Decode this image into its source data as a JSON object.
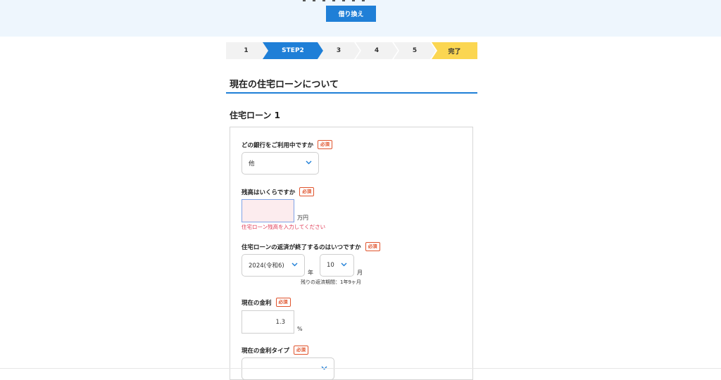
{
  "header": {
    "switch_button_label": "借り換え"
  },
  "steps": [
    {
      "label": "1",
      "state": "done"
    },
    {
      "label": "STEP2",
      "state": "active"
    },
    {
      "label": "3",
      "state": "todo"
    },
    {
      "label": "4",
      "state": "todo"
    },
    {
      "label": "5",
      "state": "todo"
    },
    {
      "label": "完了",
      "state": "final"
    }
  ],
  "colors": {
    "accent": "#1f7fd7",
    "final_step": "#fbd651",
    "required": "#e0542d",
    "error": "#e03a55",
    "header_bg": "#eef6fd"
  },
  "section": {
    "title": "現在の住宅ローンについて",
    "loan_title": "住宅ローン 1"
  },
  "form": {
    "bank": {
      "question": "どの銀行をご利用中ですか",
      "required": "必須",
      "value": "他"
    },
    "balance": {
      "question": "残高はいくらですか",
      "required": "必須",
      "value": "",
      "unit": "万円",
      "error": "住宅ローン残高を入力してください"
    },
    "end_date": {
      "question": "住宅ローンの返済が終了するのはいつですか",
      "required": "必須",
      "year_value": "2024(令和6)",
      "year_unit": "年",
      "month_value": "10",
      "month_unit": "月",
      "remaining": "残りの返済期間：1年9ヶ月"
    },
    "rate": {
      "question": "現在の金利",
      "required": "必須",
      "value": "1.3",
      "unit": "%"
    },
    "rate_type": {
      "question": "現在の金利タイプ",
      "required": "必須"
    }
  }
}
